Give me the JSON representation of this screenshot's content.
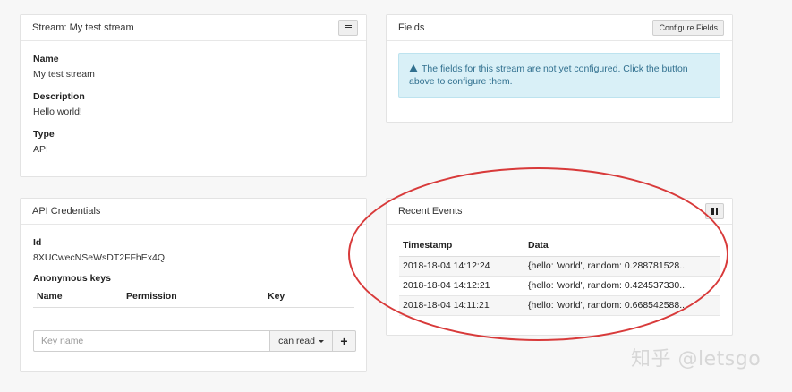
{
  "stream_panel": {
    "title": "Stream: My test stream",
    "fields": [
      {
        "label": "Name",
        "value": "My test stream"
      },
      {
        "label": "Description",
        "value": "Hello world!"
      },
      {
        "label": "Type",
        "value": "API"
      }
    ]
  },
  "fields_panel": {
    "title": "Fields",
    "configure_label": "Configure Fields",
    "alert_text": "The fields for this stream are not yet configured. Click the button above to configure them."
  },
  "credentials_panel": {
    "title": "API Credentials",
    "id_label": "Id",
    "id_value": "8XUCwecNSeWsDT2FFhEx4Q",
    "keys_label": "Anonymous keys",
    "columns": [
      "Name",
      "Permission",
      "Key"
    ],
    "key_name_placeholder": "Key name",
    "permission_selected": "can read"
  },
  "events_panel": {
    "title": "Recent Events",
    "columns": [
      "Timestamp",
      "Data"
    ],
    "rows": [
      {
        "timestamp": "2018-18-04 14:12:24",
        "data": "{hello: 'world', random: 0.288781528..."
      },
      {
        "timestamp": "2018-18-04 14:12:21",
        "data": "{hello: 'world', random: 0.424537330..."
      },
      {
        "timestamp": "2018-18-04 14:11:21",
        "data": "{hello: 'world', random: 0.668542588..."
      }
    ]
  },
  "watermark": "知乎 @letsgo",
  "colors": {
    "annotation": "#d83a3a",
    "alert_bg": "#d9f0f7",
    "alert_text": "#31708f"
  }
}
